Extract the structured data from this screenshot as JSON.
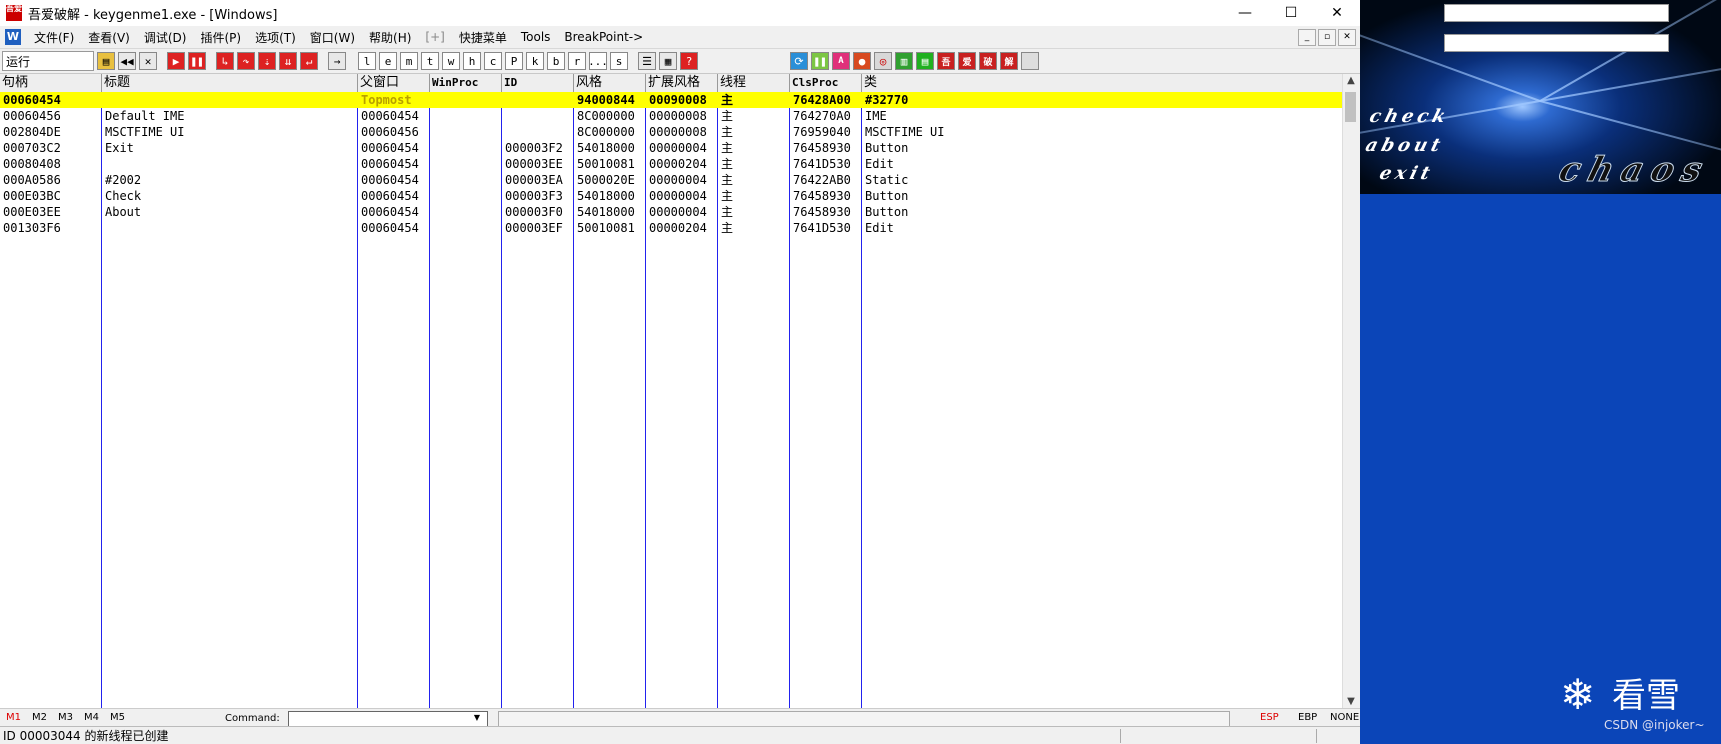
{
  "window": {
    "title": "吾爱破解 - keygenme1.exe - [Windows]",
    "app_icon_text": "吾爱",
    "minimize": "—",
    "maximize": "☐",
    "close": "✕"
  },
  "menu": {
    "icon": "W",
    "items": [
      "文件(F)",
      "查看(V)",
      "调试(D)",
      "插件(P)",
      "选项(T)",
      "窗口(W)",
      "帮助(H)",
      "[+]",
      "快捷菜单",
      "Tools",
      "BreakPoint->"
    ],
    "mdi_min": "_",
    "mdi_restore": "▫",
    "mdi_close": "✕"
  },
  "toolbar": {
    "run_label": "运行",
    "letter_buttons": [
      "l",
      "e",
      "m",
      "t",
      "w",
      "h",
      "c",
      "P",
      "k",
      "b",
      "r",
      "...",
      "s"
    ],
    "colored_buttons": [
      "A",
      "吾",
      "爱",
      "破",
      "解"
    ]
  },
  "grid": {
    "headers": [
      "句柄",
      "标题",
      "父窗口",
      "WinProc",
      "ID",
      "风格",
      "扩展风格",
      "线程",
      "ClsProc",
      "类"
    ],
    "rows": [
      {
        "handle": "00060454",
        "title": "",
        "parent": "Topmost",
        "winproc": "",
        "id": "",
        "style": "94000844",
        "exstyle": "00090008",
        "thread": "主",
        "clsproc": "76428A00",
        "cls": "#32770",
        "selected": true
      },
      {
        "handle": "00060456",
        "title": "Default IME",
        "parent": "00060454",
        "winproc": "",
        "id": "",
        "style": "8C000000",
        "exstyle": "00000008",
        "thread": "主",
        "clsproc": "764270A0",
        "cls": "IME"
      },
      {
        "handle": "002804DE",
        "title": "MSCTFIME UI",
        "parent": "00060456",
        "winproc": "",
        "id": "",
        "style": "8C000000",
        "exstyle": "00000008",
        "thread": "主",
        "clsproc": "76959040",
        "cls": "MSCTFIME UI"
      },
      {
        "handle": "000703C2",
        "title": "Exit",
        "parent": "00060454",
        "winproc": "",
        "id": "000003F2",
        "style": "54018000",
        "exstyle": "00000004",
        "thread": "主",
        "clsproc": "76458930",
        "cls": "Button"
      },
      {
        "handle": "00080408",
        "title": "",
        "parent": "00060454",
        "winproc": "",
        "id": "000003EE",
        "style": "50010081",
        "exstyle": "00000204",
        "thread": "主",
        "clsproc": "7641D530",
        "cls": "Edit"
      },
      {
        "handle": "000A0586",
        "title": "#2002",
        "parent": "00060454",
        "winproc": "",
        "id": "000003EA",
        "style": "5000020E",
        "exstyle": "00000004",
        "thread": "主",
        "clsproc": "76422AB0",
        "cls": "Static"
      },
      {
        "handle": "000E03BC",
        "title": "Check",
        "parent": "00060454",
        "winproc": "",
        "id": "000003F3",
        "style": "54018000",
        "exstyle": "00000004",
        "thread": "主",
        "clsproc": "76458930",
        "cls": "Button"
      },
      {
        "handle": "000E03EE",
        "title": "About",
        "parent": "00060454",
        "winproc": "",
        "id": "000003F0",
        "style": "54018000",
        "exstyle": "00000004",
        "thread": "主",
        "clsproc": "76458930",
        "cls": "Button"
      },
      {
        "handle": "001303F6",
        "title": "",
        "parent": "00060454",
        "winproc": "",
        "id": "000003EF",
        "style": "50010081",
        "exstyle": "00000204",
        "thread": "主",
        "clsproc": "7641D530",
        "cls": "Edit"
      }
    ]
  },
  "bottombar": {
    "marks": [
      "M1",
      "M2",
      "M3",
      "M4",
      "M5"
    ],
    "command_label": "Command:",
    "registers": [
      "ESP",
      "EBP",
      "NONE"
    ]
  },
  "status": {
    "text": "ID 00003044 的新线程已创建"
  },
  "keygen": {
    "menu": [
      "check",
      "about",
      "exit"
    ],
    "logo": "chaos"
  },
  "watermark": {
    "brand": "看雪",
    "icon": "❄",
    "sub": "CSDN @injoker~"
  },
  "colors": {
    "selected_row": "#ffff00",
    "column_divider": "#2222ee",
    "keygen_bg": "#0b45b8",
    "toolbar_red": "#dd2222"
  }
}
